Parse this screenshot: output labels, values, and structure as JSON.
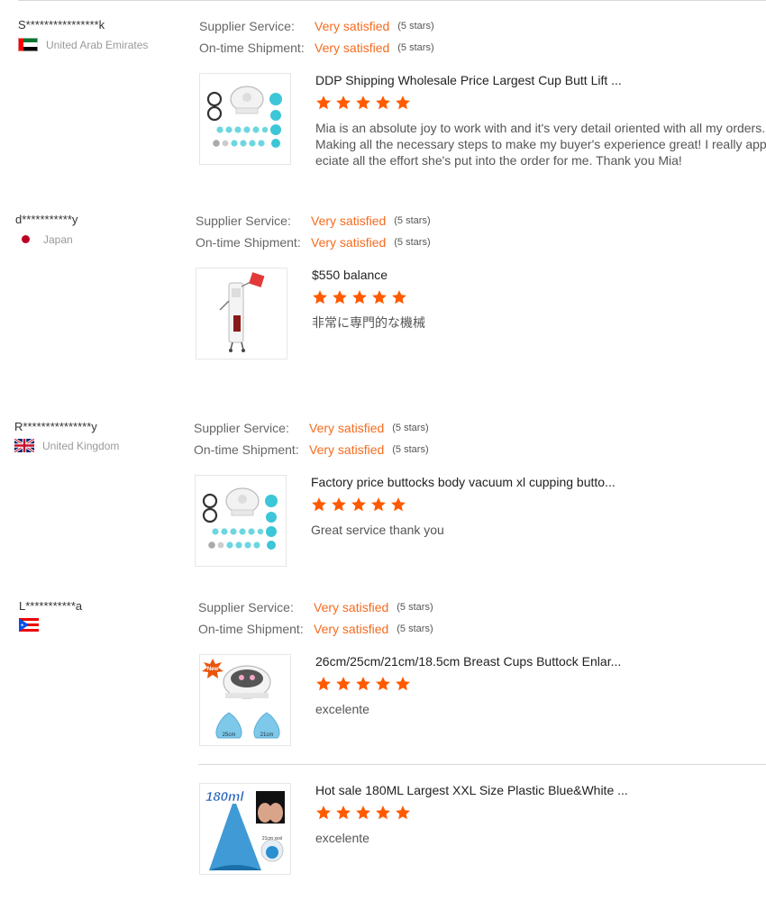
{
  "reviews": [
    {
      "buyer": "S****************k",
      "country": "United Arab Emirates",
      "flag": "uae-flag-icon",
      "supplier_label": "Supplier Service:",
      "supplier_value": "Very satisfied",
      "supplier_stars": "(5 stars)",
      "shipment_label": "On-time Shipment:",
      "shipment_value": "Very satisfied",
      "shipment_stars": "(5 stars)",
      "products": [
        {
          "title": "DDP Shipping Wholesale Price Largest Cup Butt Lift ...",
          "rating": 5,
          "comment": [
            "Mia is an absolute joy to work with and it's very detail oriented with all my orders.",
            "Making all the necessary steps to make my buyer's experience great! I really appr",
            "eciate all the effort she's put into the order for me. Thank you Mia!"
          ]
        }
      ]
    },
    {
      "buyer": "d***********y",
      "country": "Japan",
      "flag": "japan-flag-icon",
      "supplier_label": "Supplier Service:",
      "supplier_value": "Very satisfied",
      "supplier_stars": "(5 stars)",
      "shipment_label": "On-time Shipment:",
      "shipment_value": "Very satisfied",
      "shipment_stars": "(5 stars)",
      "products": [
        {
          "title": "$550 balance",
          "rating": 5,
          "comment": [
            "非常に専門的な機械"
          ]
        }
      ]
    },
    {
      "buyer": "R***************y",
      "country": "United Kingdom",
      "flag": "uk-flag-icon",
      "supplier_label": "Supplier Service:",
      "supplier_value": "Very satisfied",
      "supplier_stars": "(5 stars)",
      "shipment_label": "On-time Shipment:",
      "shipment_value": "Very satisfied",
      "shipment_stars": "(5 stars)",
      "products": [
        {
          "title": "Factory price buttocks body vacuum xl cupping butto...",
          "rating": 5,
          "comment": [
            "Great service thank you"
          ]
        }
      ]
    },
    {
      "buyer": "L***********a",
      "country": "",
      "flag": "puerto-rico-flag-icon",
      "supplier_label": "Supplier Service:",
      "supplier_value": "Very satisfied",
      "supplier_stars": "(5 stars)",
      "shipment_label": "On-time Shipment:",
      "shipment_value": "Very satisfied",
      "shipment_stars": "(5 stars)",
      "products": [
        {
          "title": "26cm/25cm/21cm/18.5cm Breast Cups Buttock Enlar...",
          "rating": 5,
          "comment": [
            "excelente"
          ],
          "badge": "New",
          "cup_labels": [
            "25cm",
            "21cm"
          ]
        },
        {
          "title": "Hot sale 180ML Largest XXL Size Plastic Blue&White ...",
          "rating": 5,
          "comment": [
            "excelente"
          ],
          "badge": "180ml",
          "cup_labels": [
            "21cm xxxl"
          ]
        }
      ]
    }
  ],
  "colors": {
    "accent": "#f56b1f",
    "star": "#ff5a00",
    "muted": "#999999"
  }
}
